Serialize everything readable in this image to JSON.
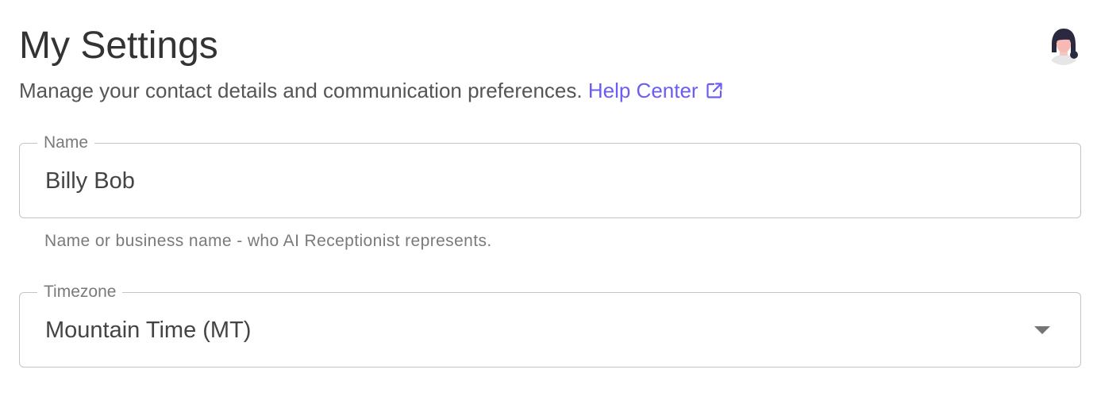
{
  "header": {
    "title": "My Settings",
    "subtitle": "Manage your contact details and communication preferences.",
    "help_link_label": "Help Center",
    "help_link_icon": "external-link-icon",
    "link_color": "#6a5cf5"
  },
  "user": {
    "avatar_icon": "user-avatar-icon"
  },
  "form": {
    "name": {
      "label": "Name",
      "value": "Billy Bob",
      "helper_text": "Name or business name - who AI Receptionist represents."
    },
    "timezone": {
      "label": "Timezone",
      "selected": "Mountain Time (MT)",
      "dropdown_icon": "caret-down-icon"
    }
  }
}
